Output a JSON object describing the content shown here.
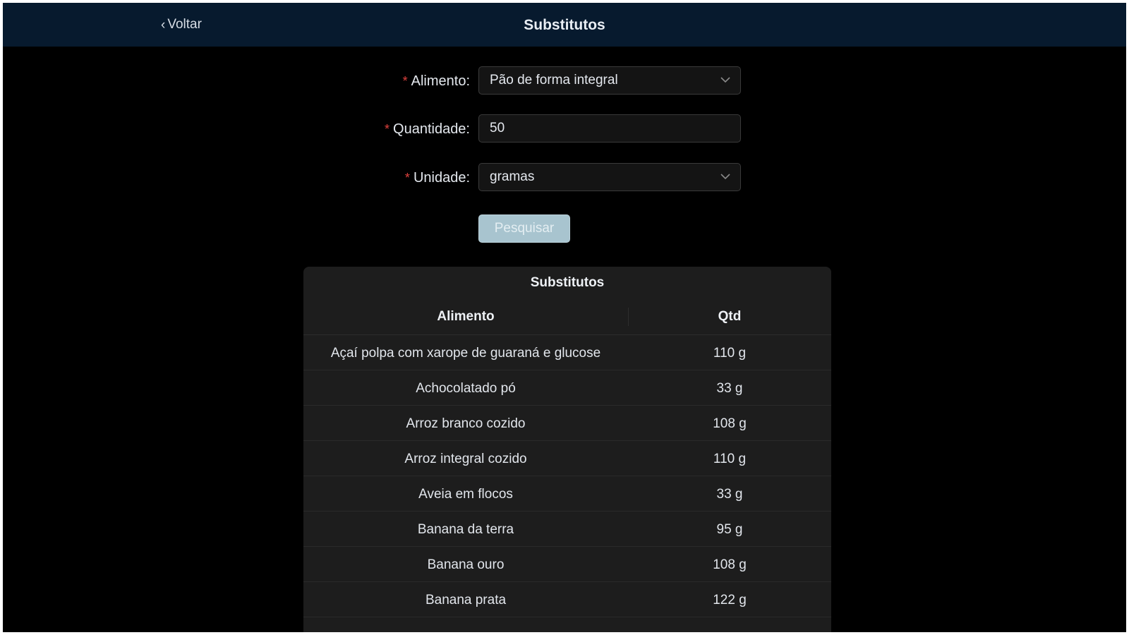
{
  "header": {
    "back_label": "Voltar",
    "title": "Substitutos"
  },
  "form": {
    "alimento": {
      "label": "Alimento:",
      "value": "Pão de forma integral"
    },
    "quantidade": {
      "label": "Quantidade:",
      "value": "50"
    },
    "unidade": {
      "label": "Unidade:",
      "value": "gramas"
    },
    "required_mark": "*",
    "search_label": "Pesquisar"
  },
  "table": {
    "title": "Substitutos",
    "columns": [
      "Alimento",
      "Qtd"
    ],
    "rows": [
      {
        "alimento": "Açaí polpa com xarope de guaraná e glucose",
        "qtd": "110 g"
      },
      {
        "alimento": "Achocolatado pó",
        "qtd": "33 g"
      },
      {
        "alimento": "Arroz branco cozido",
        "qtd": "108 g"
      },
      {
        "alimento": "Arroz integral cozido",
        "qtd": "110 g"
      },
      {
        "alimento": "Aveia em flocos",
        "qtd": "33 g"
      },
      {
        "alimento": "Banana da terra",
        "qtd": "95 g"
      },
      {
        "alimento": "Banana ouro",
        "qtd": "108 g"
      },
      {
        "alimento": "Banana prata",
        "qtd": "122 g"
      }
    ]
  },
  "colors": {
    "header_bg": "#071a2e",
    "page_bg": "#000000",
    "required": "#e0423e",
    "button_bg": "#a8c4cf",
    "table_bg": "#1d1d1d"
  }
}
